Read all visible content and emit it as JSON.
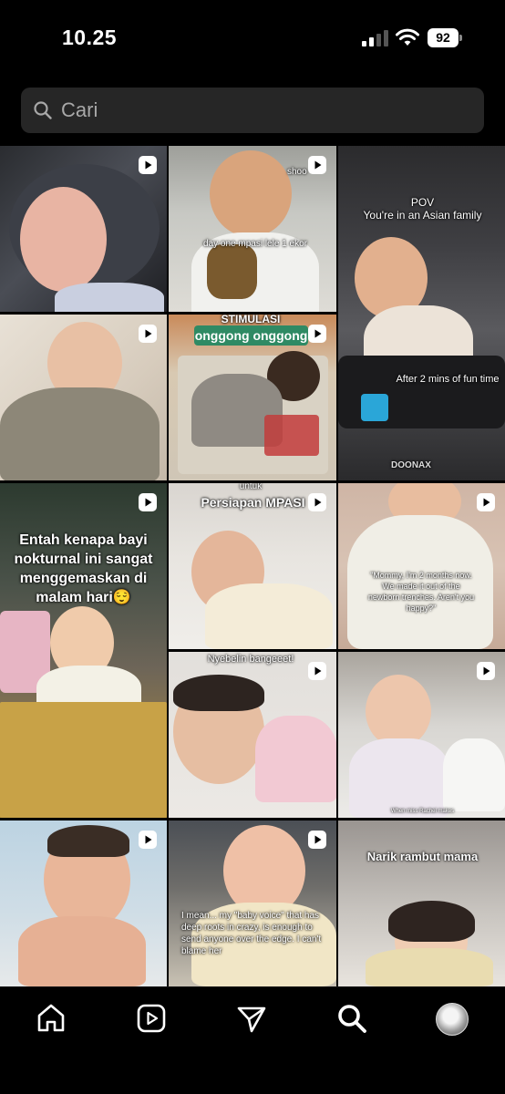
{
  "status": {
    "time": "10.25",
    "battery": "92"
  },
  "search": {
    "placeholder": "Cari"
  },
  "tiles": [
    {
      "id": "t1",
      "caption": ""
    },
    {
      "id": "t2",
      "caption": "day one mpasi lele 1 ekor",
      "corner": "shoo"
    },
    {
      "id": "t3",
      "caption": "POV\nYou're in an Asian family",
      "caption2": "After 2 mins of fun time",
      "brand": "DOONAX"
    },
    {
      "id": "t4",
      "caption": ""
    },
    {
      "id": "t5",
      "banner1": "STIMULASI",
      "banner2": "onggong onggong"
    },
    {
      "id": "t6",
      "caption": "Entah kenapa bayi nokturnal ini sangat menggemaskan di malam hari😌"
    },
    {
      "id": "t7",
      "top": "untuk",
      "caption": "Persiapan MPASI"
    },
    {
      "id": "t8",
      "caption": "\"Mommy, I'm 2 months now. We made it out of the newborn trenches. Aren't you happy?\""
    },
    {
      "id": "t9",
      "caption": "Nyebelin bangeeet!"
    },
    {
      "id": "t10",
      "caption": "When miss Rachel makes"
    },
    {
      "id": "t11",
      "caption": ""
    },
    {
      "id": "t12",
      "caption": "I mean... my \"baby voice\" that has deep roots in crazy, is enough to send anyone over the edge. I can't blame her"
    },
    {
      "id": "t13",
      "caption": "Narik rambut mama"
    },
    {
      "id": "t14",
      "caption": ""
    }
  ],
  "nav": [
    "home-icon",
    "reels-icon",
    "send-icon",
    "search-icon",
    "profile-avatar"
  ]
}
